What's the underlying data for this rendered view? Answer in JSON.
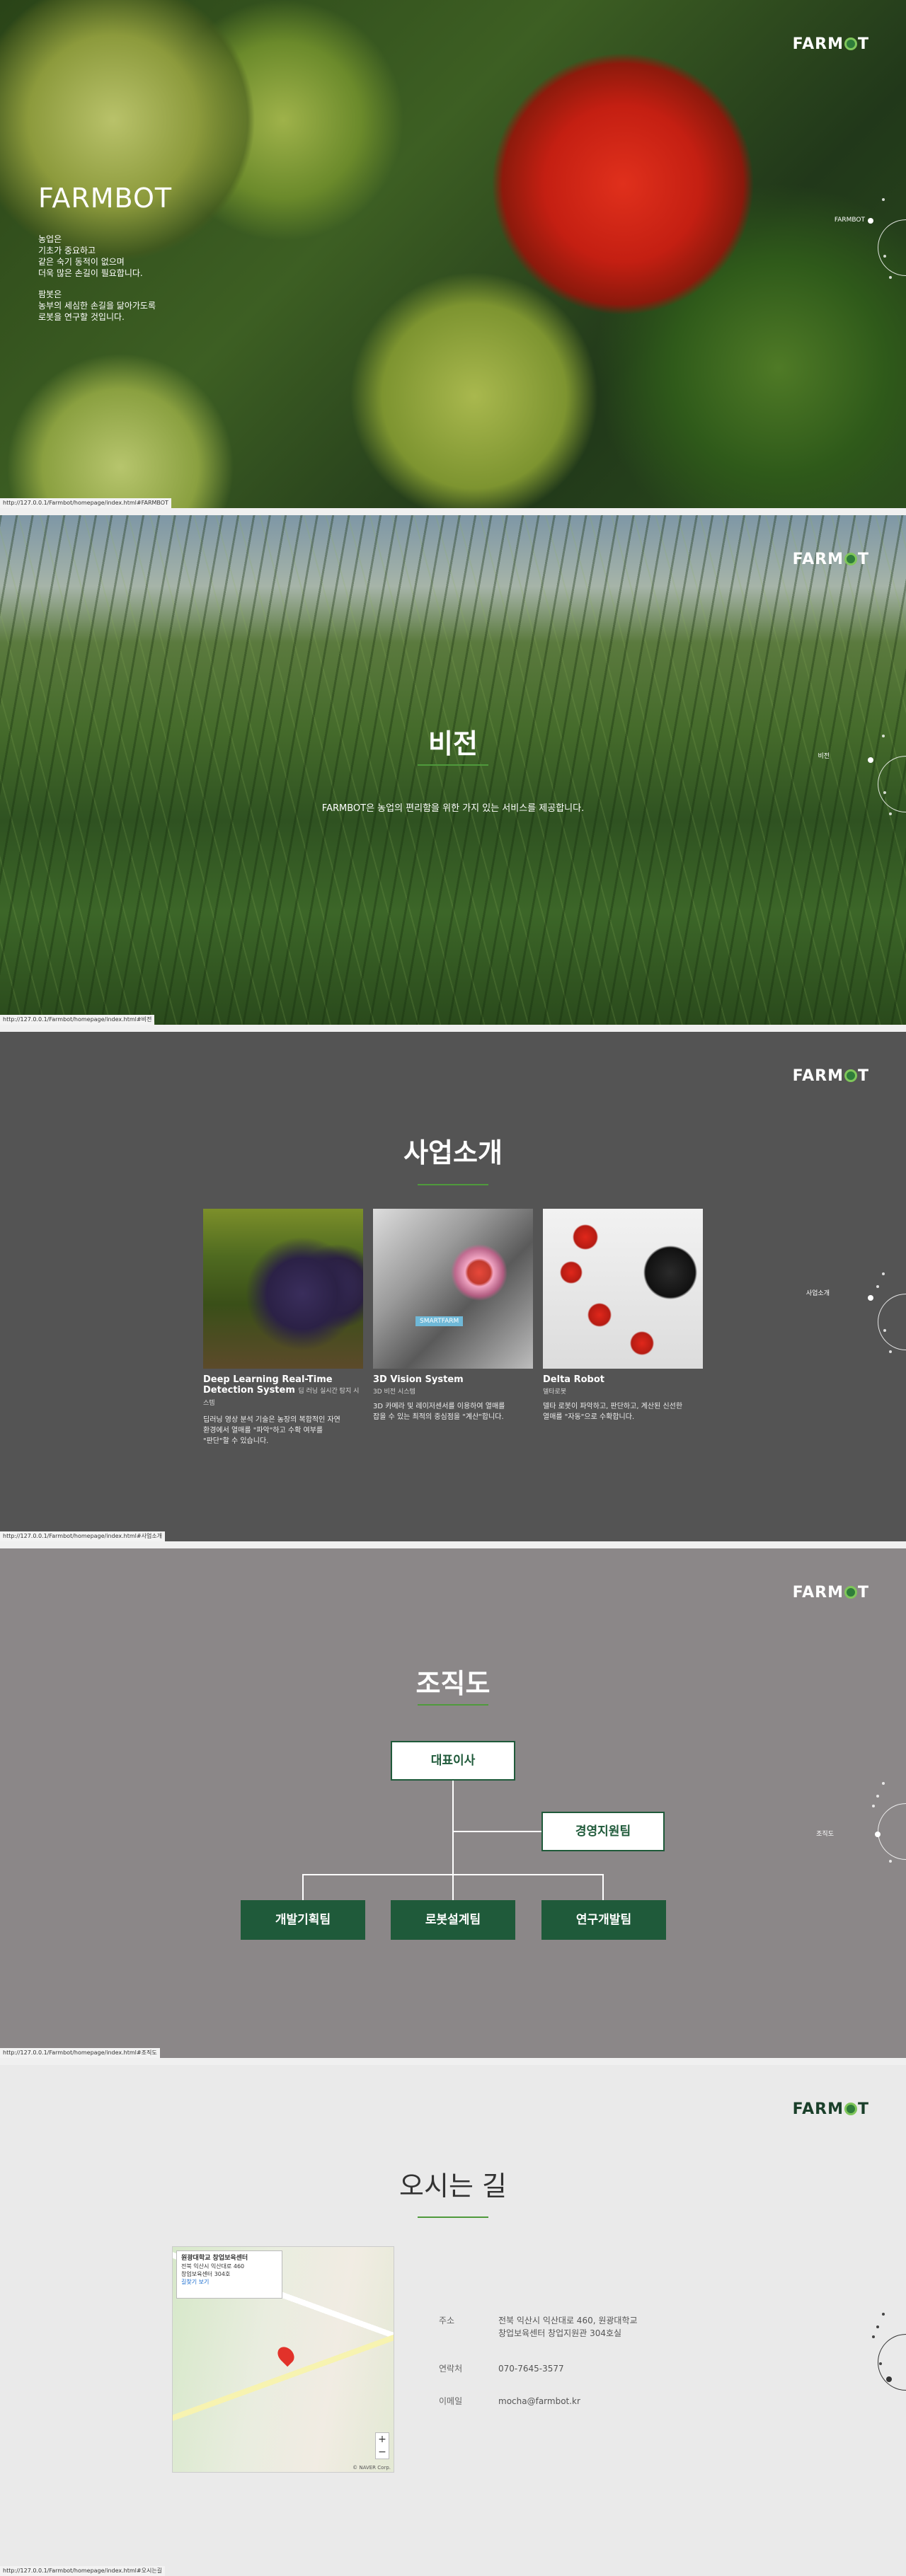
{
  "brand": {
    "logo_left": "FARM",
    "logo_right": "T"
  },
  "hero": {
    "title": "FARMBOT",
    "p1_l1": "농업은",
    "p1_l2": "기초가 중요하고",
    "p1_l3": "같은 숙기 동적이 없으며",
    "p1_l4": "더욱 많은 손길이 필요합니다.",
    "p2_l1": "팜봇은",
    "p2_l2": "농부의 세심한 손길을 닮아가도록",
    "p2_l3": "로봇을 연구할 것입니다.",
    "nav_label": "FARMBOT",
    "url": "http://127.0.0.1/Farmbot/homepage/index.html#FARMBOT"
  },
  "vision": {
    "title": "비전",
    "subtitle": "FARMBOT은 농업의 편리함을 위한 가지 있는 서비스를 제공합니다.",
    "nav_label": "비전",
    "url": "http://127.0.0.1/Farmbot/homepage/index.html#비전"
  },
  "business": {
    "title": "사업소개",
    "nav_label": "사업소개",
    "url": "http://127.0.0.1/Farmbot/homepage/index.html#사업소개",
    "cards": [
      {
        "title_l1": "Deep Learning Real-Time",
        "title_l2": "Detection System",
        "title_small": "딥 러닝 실시간 탐지 시스템",
        "subtitle": "",
        "desc_l1": "딥러닝 영상 분석 기술은 농장의 복합적인 자연",
        "desc_l2": "환경에서 열매를 \"파악\"하고 수확 여부를",
        "desc_l3": "\"판단\"할 수 있습니다.",
        "tag": ""
      },
      {
        "title_l1": "3D Vision System",
        "title_l2": "",
        "title_small": "",
        "subtitle": "3D 비전 시스템",
        "desc_l1": "3D 카메라 및 레이저센서를 이용하여 열매를",
        "desc_l2": "잡을 수 있는 최적의 중심점을 \"계산\"합니다.",
        "desc_l3": "",
        "tag": "SMARTFARM"
      },
      {
        "title_l1": "Delta Robot",
        "title_l2": "",
        "title_small": "",
        "subtitle": "델타로봇",
        "desc_l1": "델타 로봇이 파악하고, 판단하고, 계산된 신선한",
        "desc_l2": "열매를 \"자동\"으로 수확합니다.",
        "desc_l3": "",
        "tag": ""
      }
    ]
  },
  "org": {
    "title": "조직도",
    "nav_label": "조직도",
    "url": "http://127.0.0.1/Farmbot/homepage/index.html#조직도",
    "ceo": "대표이사",
    "support": "경영지원팀",
    "teams": [
      "개발기획팀",
      "로봇설계팀",
      "연구개발팀"
    ]
  },
  "location": {
    "title": "오시는 길",
    "url": "http://127.0.0.1/Farmbot/homepage/index.html#오시는길",
    "popup_title": "원광대학교 창업보육센터",
    "popup_l1": "전북 익산시 익산대로 460",
    "popup_l2": "창업보육센터 304호",
    "popup_link": "길찾기 보기",
    "map_copy": "© NAVER Corp.",
    "zoom_in": "+",
    "zoom_out": "−",
    "address_label": "주소",
    "address_l1": "전북 익산시 익산대로 460, 원광대학교",
    "address_l2": "창업보육센터 창업지원관 304호실",
    "phone_label": "연락처",
    "phone": "070-7645-3577",
    "email_label": "이메일",
    "email": "mocha@farmbot.kr"
  }
}
